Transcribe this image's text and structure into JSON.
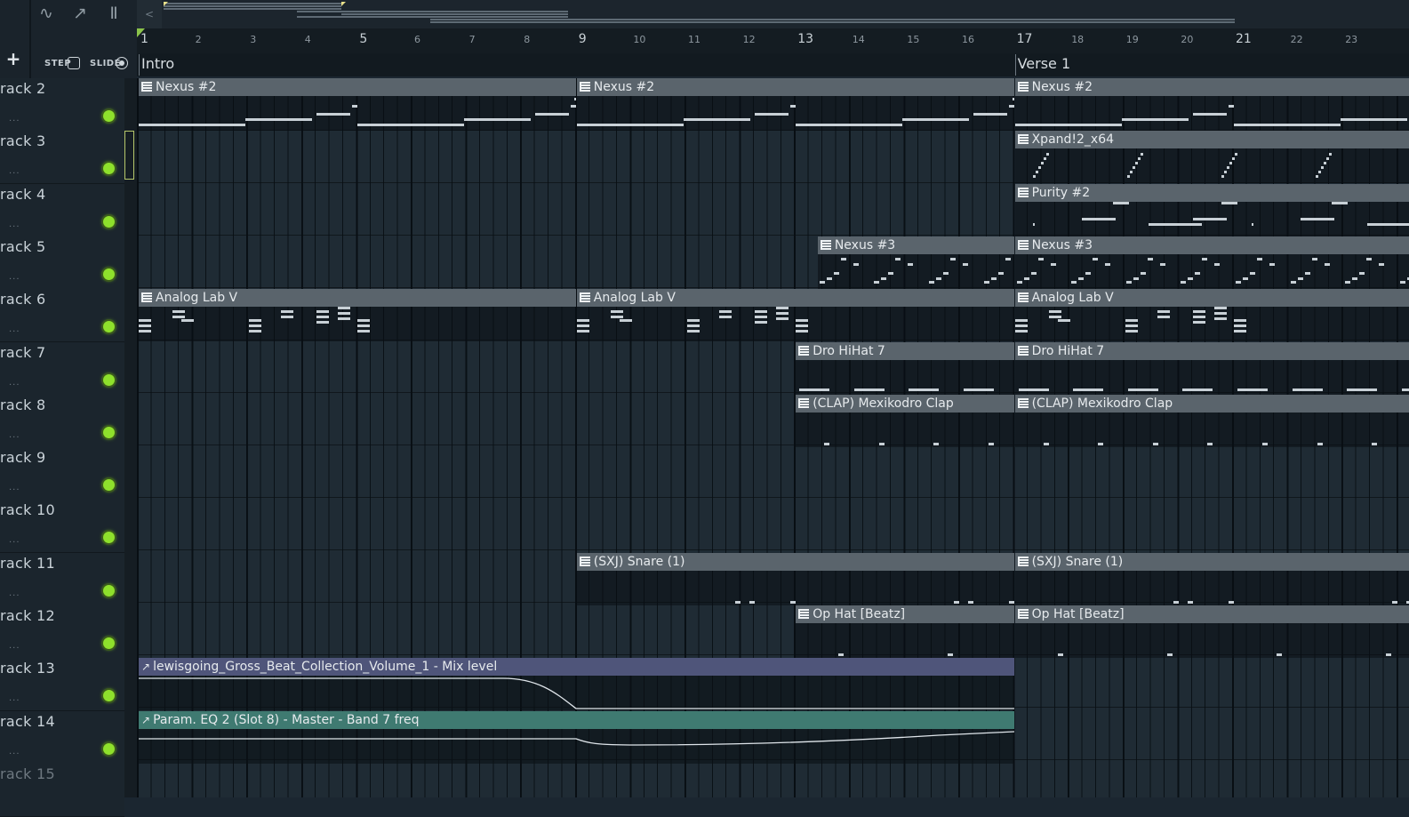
{
  "toolbar": {
    "tools": [
      "waveform-icon",
      "automation-icon",
      "piano-icon"
    ],
    "add_label": "+",
    "step_label": "STEP",
    "slide_label": "SLIDE"
  },
  "overview": {
    "scroll_left_label": "<"
  },
  "ruler": {
    "bars": [
      "1",
      "2",
      "3",
      "4",
      "5",
      "6",
      "7",
      "8",
      "9",
      "10",
      "11",
      "12",
      "13",
      "14",
      "15",
      "16",
      "17",
      "18",
      "19",
      "20",
      "21",
      "22",
      "23"
    ],
    "major": [
      "1",
      "5",
      "9",
      "13",
      "17",
      "21"
    ]
  },
  "markers": [
    {
      "label": "Intro",
      "bar": 1
    },
    {
      "label": "Verse 1",
      "bar": 17
    }
  ],
  "tracks": [
    {
      "name": "rack 2",
      "dots": "..."
    },
    {
      "name": "rack 3",
      "dots": "..."
    },
    {
      "name": "rack 4",
      "dots": "..."
    },
    {
      "name": "rack 5",
      "dots": "..."
    },
    {
      "name": "rack 6",
      "dots": "..."
    },
    {
      "name": "rack 7",
      "dots": "..."
    },
    {
      "name": "rack 8",
      "dots": "..."
    },
    {
      "name": "rack 9",
      "dots": "..."
    },
    {
      "name": "rack 10",
      "dots": "..."
    },
    {
      "name": "rack 11",
      "dots": "..."
    },
    {
      "name": "rack 12",
      "dots": "..."
    },
    {
      "name": "rack 13",
      "dots": "..."
    },
    {
      "name": "rack 14",
      "dots": "..."
    },
    {
      "name": "rack 15",
      "dots": ""
    }
  ],
  "clips": [
    {
      "track": 0,
      "start": 1,
      "end": 9,
      "label": "Nexus #2",
      "kind": "pattern",
      "style": "steps"
    },
    {
      "track": 0,
      "start": 9,
      "end": 17,
      "label": "Nexus #2",
      "kind": "pattern",
      "style": "steps"
    },
    {
      "track": 0,
      "start": 17,
      "end": 25,
      "label": "Nexus #2",
      "kind": "pattern",
      "style": "steps"
    },
    {
      "track": 1,
      "start": 17,
      "end": 25,
      "label": "Xpand!2_x64",
      "kind": "pattern",
      "style": "arp"
    },
    {
      "track": 2,
      "start": 17,
      "end": 25,
      "label": "Purity #2",
      "kind": "pattern",
      "style": "sparse"
    },
    {
      "track": 3,
      "start": 13.4,
      "end": 17,
      "label": "Nexus #3",
      "kind": "pattern",
      "style": "arp2"
    },
    {
      "track": 3,
      "start": 17,
      "end": 25,
      "label": "Nexus #3",
      "kind": "pattern",
      "style": "arp2"
    },
    {
      "track": 4,
      "start": 1,
      "end": 9,
      "label": "Analog Lab V",
      "kind": "pattern",
      "style": "chords"
    },
    {
      "track": 4,
      "start": 9,
      "end": 17,
      "label": "Analog Lab V",
      "kind": "pattern",
      "style": "chords"
    },
    {
      "track": 4,
      "start": 17,
      "end": 25,
      "label": "Analog Lab V",
      "kind": "pattern",
      "style": "chords"
    },
    {
      "track": 5,
      "start": 13,
      "end": 17,
      "label": "Dro HiHat 7",
      "kind": "pattern",
      "style": "hats"
    },
    {
      "track": 5,
      "start": 17,
      "end": 25,
      "label": "Dro HiHat 7",
      "kind": "pattern",
      "style": "hats"
    },
    {
      "track": 6,
      "start": 13,
      "end": 17,
      "label": "(CLAP) Mexikodro Clap",
      "kind": "pattern",
      "style": "clap"
    },
    {
      "track": 6,
      "start": 17,
      "end": 25,
      "label": "(CLAP) Mexikodro Clap",
      "kind": "pattern",
      "style": "clap"
    },
    {
      "track": 9,
      "start": 9,
      "end": 17,
      "label": "(SXJ) Snare (1)",
      "kind": "pattern",
      "style": "snare"
    },
    {
      "track": 9,
      "start": 17,
      "end": 25,
      "label": "(SXJ) Snare (1)",
      "kind": "pattern",
      "style": "snare"
    },
    {
      "track": 10,
      "start": 13,
      "end": 17,
      "label": "Op Hat [Beatz]",
      "kind": "pattern",
      "style": "ohat"
    },
    {
      "track": 10,
      "start": 17,
      "end": 25,
      "label": "Op Hat [Beatz]",
      "kind": "pattern",
      "style": "ohat"
    },
    {
      "track": 11,
      "start": 1,
      "end": 17,
      "label": "lewisgoing_Gross_Beat_Collection_Volume_1 - Mix level",
      "kind": "automation",
      "style": "curve1"
    },
    {
      "track": 12,
      "start": 1,
      "end": 17,
      "label": "Param. EQ 2 (Slot 8) - Master - Band 7 freq",
      "kind": "automation",
      "style": "curve2"
    }
  ],
  "colors": {
    "pattern_header": "#5a646c",
    "automation_header_1": "#4f557a",
    "automation_header_2": "#3f7a71",
    "led_on": "#8ee02c",
    "playhead": "#8bc34a"
  }
}
